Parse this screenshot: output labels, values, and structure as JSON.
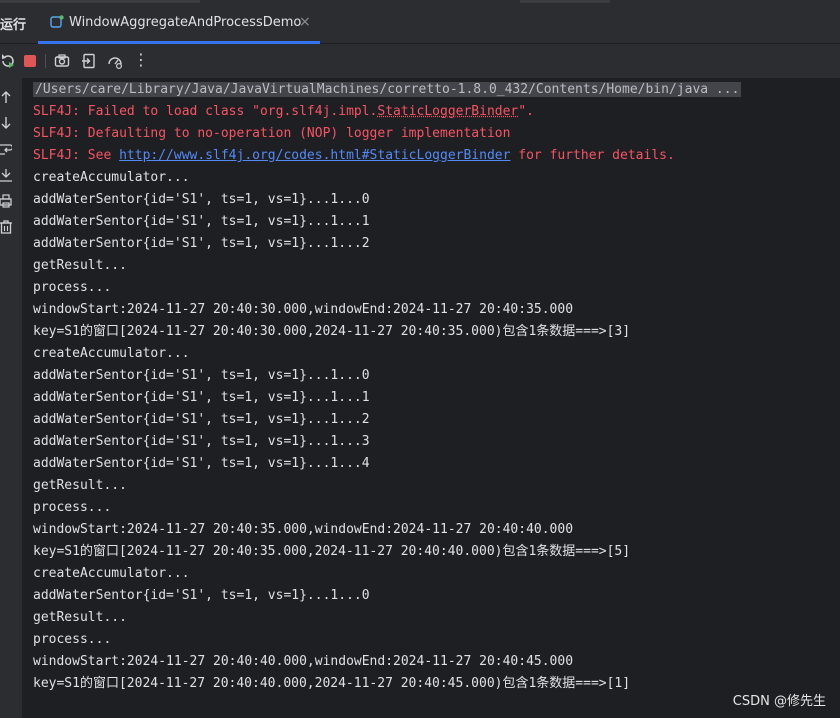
{
  "panel": {
    "title": "运行"
  },
  "tab": {
    "label": "WindowAggregateAndProcessDemo",
    "close_glyph": "×"
  },
  "toolbar": {
    "icons": [
      "rerun-icon",
      "stop-icon",
      "more-icon"
    ],
    "more_glyph": "⋮"
  },
  "colors": {
    "background": "#1e1f22",
    "panel": "#2b2d30",
    "error_text": "#f75464",
    "link_text": "#548af7",
    "tab_underline": "#3574f0"
  },
  "console": {
    "command": "/Users/care/Library/Java/JavaVirtualMachines/corretto-1.8.0_432/Contents/Home/bin/java ...",
    "slf4j_line1_prefix": "SLF4J: Failed to load class \"org.slf4j.impl.",
    "slf4j_line1_class": "StaticLoggerBinder",
    "slf4j_line1_suffix": "\".",
    "slf4j_line2": "SLF4J: Defaulting to no-operation (NOP) logger implementation",
    "slf4j_line3_prefix": "SLF4J: See ",
    "slf4j_line3_link": "http://www.slf4j.org/codes.html#StaticLoggerBinder",
    "slf4j_line3_suffix": " for further details.",
    "lines": [
      "createAccumulator...",
      "addWaterSentor{id='S1', ts=1, vs=1}...1...0",
      "addWaterSentor{id='S1', ts=1, vs=1}...1...1",
      "addWaterSentor{id='S1', ts=1, vs=1}...1...2",
      "getResult...",
      "process...",
      "windowStart:2024-11-27 20:40:30.000,windowEnd:2024-11-27 20:40:35.000",
      "key=S1的窗口[2024-11-27 20:40:30.000,2024-11-27 20:40:35.000)包含1条数据===>[3]",
      "createAccumulator...",
      "addWaterSentor{id='S1', ts=1, vs=1}...1...0",
      "addWaterSentor{id='S1', ts=1, vs=1}...1...1",
      "addWaterSentor{id='S1', ts=1, vs=1}...1...2",
      "addWaterSentor{id='S1', ts=1, vs=1}...1...3",
      "addWaterSentor{id='S1', ts=1, vs=1}...1...4",
      "getResult...",
      "process...",
      "windowStart:2024-11-27 20:40:35.000,windowEnd:2024-11-27 20:40:40.000",
      "key=S1的窗口[2024-11-27 20:40:35.000,2024-11-27 20:40:40.000)包含1条数据===>[5]",
      "createAccumulator...",
      "addWaterSentor{id='S1', ts=1, vs=1}...1...0",
      "getResult...",
      "process...",
      "windowStart:2024-11-27 20:40:40.000,windowEnd:2024-11-27 20:40:45.000",
      "key=S1的窗口[2024-11-27 20:40:40.000,2024-11-27 20:40:45.000)包含1条数据===>[1]"
    ]
  },
  "watermark": "CSDN @修先生"
}
